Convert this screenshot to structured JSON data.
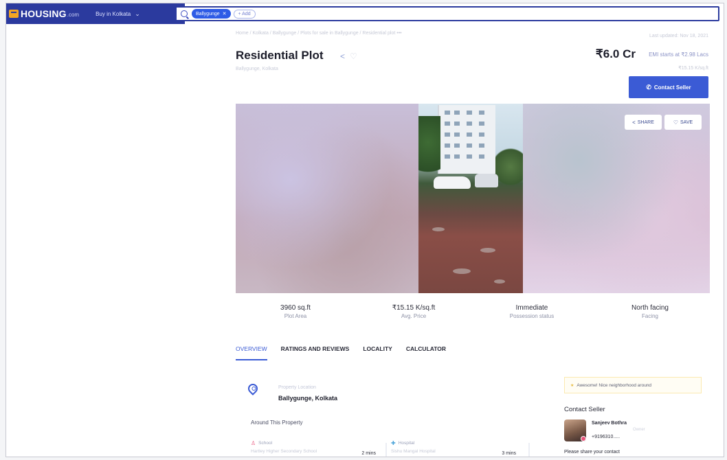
{
  "header": {
    "logo_text": "HOUSING",
    "logo_suffix": ".com",
    "location_selector": "Buy in Kolkata",
    "search_chip": "Ballygunge",
    "add_chip": "+ Add"
  },
  "listing": {
    "breadcrumb": "Home / Kolkata / Ballygunge / Plots for sale in Ballygunge / Residential plot •••",
    "updated": "Last updated: Nov 18, 2021",
    "title": "Residential Plot",
    "sublocation": "Ballygunge, Kolkata",
    "price": "₹6.0 Cr",
    "emi": "EMI starts at ₹2.98 Lacs",
    "price_per_sqft_top": "₹15.15 K/sq.ft",
    "contact_button": "Contact Seller"
  },
  "gallery": {
    "share_label": "SHARE",
    "save_label": "SAVE"
  },
  "stats": [
    {
      "value": "3960 sq.ft",
      "label": "Plot Area"
    },
    {
      "value": "₹15.15 K/sq.ft",
      "label": "Avg. Price"
    },
    {
      "value": "Immediate",
      "label": "Possession status"
    },
    {
      "value": "North facing",
      "label": "Facing"
    }
  ],
  "tabs": [
    {
      "label": "OVERVIEW",
      "active": true
    },
    {
      "label": "RATINGS AND REVIEWS"
    },
    {
      "label": "LOCALITY"
    },
    {
      "label": "CALCULATOR"
    }
  ],
  "overview": {
    "location_label": "Property Location",
    "location_value": "Ballygunge, Kolkata",
    "around_title": "Around This Property",
    "amenities": [
      {
        "category": "School",
        "name": "Hartley Higher Secondary School",
        "time": "2 mins"
      },
      {
        "category": "Hospital",
        "name": "Sishu Mangal Hospital",
        "time": "3 mins"
      }
    ]
  },
  "sidebar": {
    "review_snippet": "Awesome! Nice neighborhood around",
    "contact_title": "Contact Seller",
    "seller_name": "Sanjeev Bothra",
    "seller_tag": "Owner",
    "seller_phone": "+9196310.....",
    "share_contact": "Please share your contact"
  }
}
